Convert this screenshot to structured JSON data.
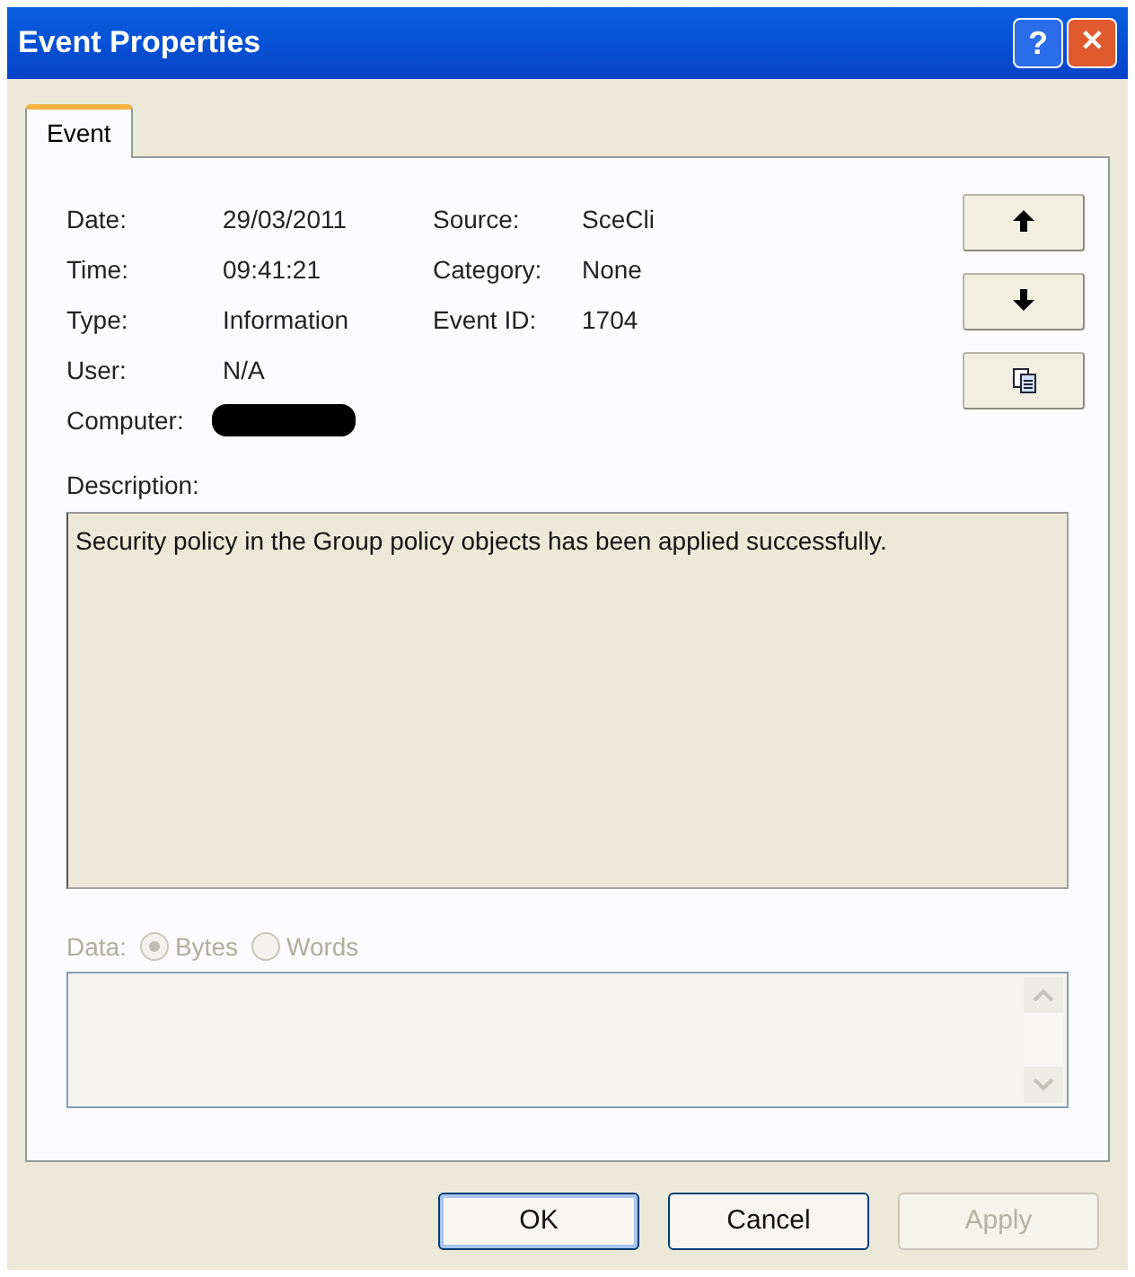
{
  "window": {
    "title": "Event Properties",
    "buttons": [
      "?",
      "✕"
    ]
  },
  "tabs": [
    {
      "label": "Event",
      "selected": true
    }
  ],
  "fields": [
    {
      "label": "Date:",
      "value": "29/03/2011"
    },
    {
      "label": "Time:",
      "value": "09:41:21"
    },
    {
      "label": "Type:",
      "value": "Information"
    },
    {
      "label": "User:",
      "value": "N/A"
    },
    {
      "label": "Computer:",
      "redacted": true
    }
  ],
  "fields_right": [
    {
      "label": "Source:",
      "value": "SceCli"
    },
    {
      "label": "Category:",
      "value": "None"
    },
    {
      "label": "Event ID:",
      "value": "1704"
    }
  ],
  "side_buttons": [
    {
      "kind": "up"
    },
    {
      "kind": "down"
    },
    {
      "kind": "copy"
    }
  ],
  "description": {
    "label": "Description:",
    "text": "Security policy in the Group policy objects has been applied successfully."
  },
  "data": {
    "label": "Data:",
    "disabled": true,
    "options": [
      {
        "label": "Bytes",
        "selected": true
      },
      {
        "label": "Words",
        "selected": false
      }
    ]
  },
  "buttons": [
    {
      "label": "OK",
      "disabled": false,
      "default": true
    },
    {
      "label": "Cancel",
      "disabled": false,
      "default": false
    },
    {
      "label": "Apply",
      "disabled": true,
      "default": false
    }
  ]
}
